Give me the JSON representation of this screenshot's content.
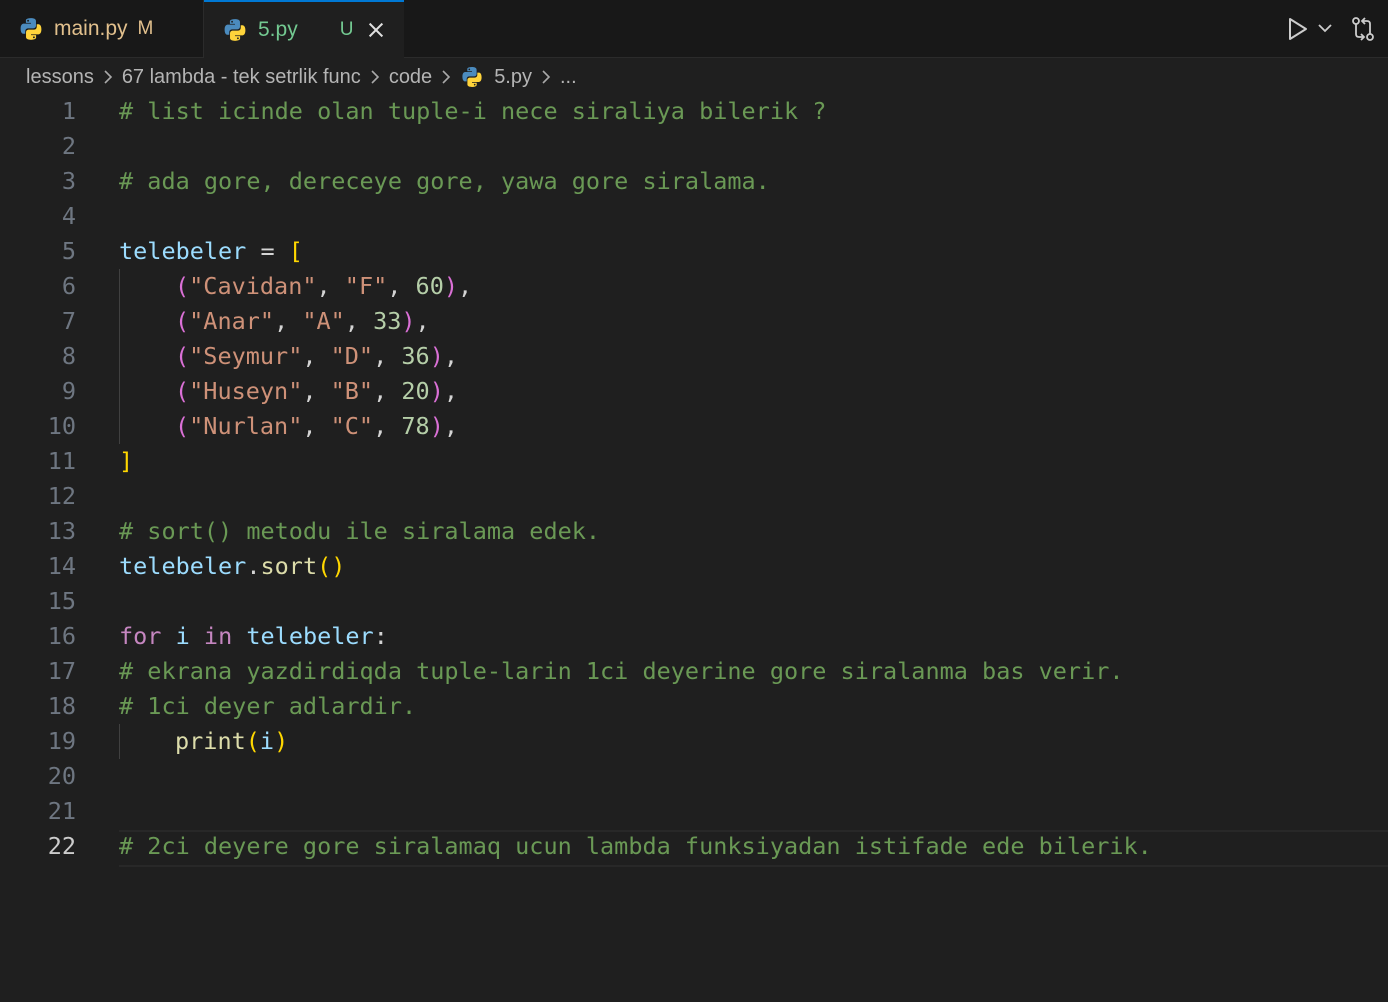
{
  "tabs": [
    {
      "name": "main.py",
      "status": "M"
    },
    {
      "name": "5.py",
      "status": "U"
    }
  ],
  "breadcrumb": [
    "lessons",
    "67 lambda - tek setrlik func",
    "code",
    "5.py",
    "..."
  ],
  "editor": {
    "active_line": 22,
    "line_numbers": [
      "1",
      "2",
      "3",
      "4",
      "5",
      "6",
      "7",
      "8",
      "9",
      "10",
      "11",
      "12",
      "13",
      "14",
      "15",
      "16",
      "17",
      "18",
      "19",
      "20",
      "21",
      "22"
    ],
    "lines": {
      "l1": "# list icinde olan tuple-i nece siraliya bilerik ?",
      "l3": "# ada gore, dereceye gore, yawa gore siralama.",
      "l5_var": "telebeler",
      "l5_op": " = ",
      "l5_br": "[",
      "rows": [
        {
          "name": "\"Cavidan\"",
          "grade": "\"F\"",
          "age": "60"
        },
        {
          "name": "\"Anar\"",
          "grade": "\"A\"",
          "age": "33"
        },
        {
          "name": "\"Seymur\"",
          "grade": "\"D\"",
          "age": "36"
        },
        {
          "name": "\"Huseyn\"",
          "grade": "\"B\"",
          "age": "20"
        },
        {
          "name": "\"Nurlan\"",
          "grade": "\"C\"",
          "age": "78"
        }
      ],
      "l11": "]",
      "l13": "# sort() metodu ile siralama edek.",
      "l14_var": "telebeler",
      "l14_dot": ".",
      "l14_fn": "sort",
      "l14_br": "()",
      "l16_for": "for",
      "l16_i": "i",
      "l16_in": "in",
      "l16_var": "telebeler",
      "l16_colon": ":",
      "l17": "# ekrana yazdirdiqda tuple-larin 1ci deyerine gore siralanma bas verir.",
      "l18": "# 1ci deyer adlardir.",
      "l19_fn": "print",
      "l19_open": "(",
      "l19_arg": "i",
      "l19_close": ")",
      "l22": "# 2ci deyere gore siralamaq ucun lambda funksiyadan istifade ede bilerik."
    }
  }
}
